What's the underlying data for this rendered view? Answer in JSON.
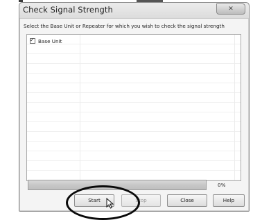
{
  "dialog": {
    "title": "Check Signal Strength",
    "close_glyph": "✕",
    "instruction": "Select the Base Unit or Repeater for which you wish to check the signal strength"
  },
  "unit_list": {
    "items": [
      {
        "label": "Base Unit",
        "checked": true,
        "check_glyph": "✓"
      }
    ]
  },
  "progress": {
    "value_percent": 0,
    "label": "0%"
  },
  "buttons": {
    "start": "Start",
    "stop": "Stop",
    "close": "Close",
    "help": "Help"
  },
  "colors": {
    "progress_fill": "#5bbf3a",
    "annotation_ellipse": "#0a0a0a"
  },
  "icons": {
    "close": "close-icon",
    "pointer": "mouse-pointer-icon"
  }
}
